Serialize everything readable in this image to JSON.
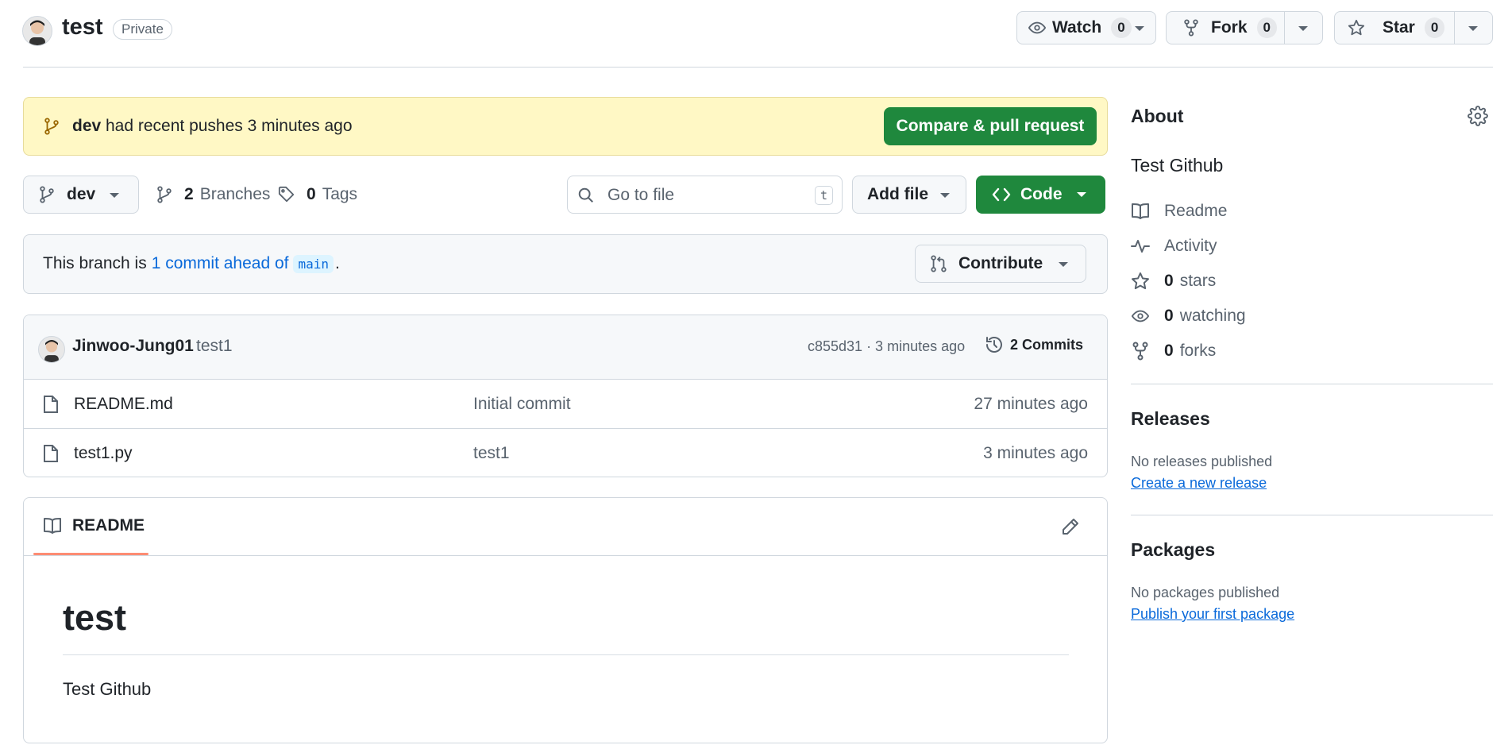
{
  "repo": {
    "name": "test",
    "visibility": "Private"
  },
  "actions": {
    "watch": {
      "label": "Watch",
      "count": "0"
    },
    "fork": {
      "label": "Fork",
      "count": "0"
    },
    "star": {
      "label": "Star",
      "count": "0"
    }
  },
  "banner": {
    "branch": "dev",
    "text": "had recent pushes 3 minutes ago",
    "button": "Compare & pull request"
  },
  "toolbar": {
    "branch": "dev",
    "branches_count": "2",
    "branches_label": "Branches",
    "tags_count": "0",
    "tags_label": "Tags",
    "search_placeholder": "Go to file",
    "search_shortcut": "t",
    "add_file": "Add file",
    "code": "Code"
  },
  "branch_status": {
    "prefix": "This branch is",
    "link": "1 commit ahead of",
    "base": "main",
    "suffix": ".",
    "contribute": "Contribute"
  },
  "latest_commit": {
    "author": "Jinwoo-Jung01",
    "message": "test1",
    "meta": "c855d31 · 3 minutes ago",
    "commits": "2 Commits"
  },
  "files": [
    {
      "name": "README.md",
      "message": "Initial commit",
      "time": "27 minutes ago"
    },
    {
      "name": "test1.py",
      "message": "test1",
      "time": "3 minutes ago"
    }
  ],
  "readme": {
    "tab": "README",
    "heading": "test",
    "body": "Test Github"
  },
  "about": {
    "title": "About",
    "description": "Test Github",
    "readme": "Readme",
    "activity": "Activity",
    "stars_count": "0",
    "stars_label": "stars",
    "watching_count": "0",
    "watching_label": "watching",
    "forks_count": "0",
    "forks_label": "forks"
  },
  "releases": {
    "title": "Releases",
    "empty": "No releases published",
    "link": "Create a new release"
  },
  "packages": {
    "title": "Packages",
    "empty": "No packages published",
    "link": "Publish your first package"
  },
  "colors": {
    "accent_green": "#1f883d",
    "link_blue": "#0969da",
    "banner_bg": "#fff8c5",
    "tab_underline": "#fd8c73"
  }
}
